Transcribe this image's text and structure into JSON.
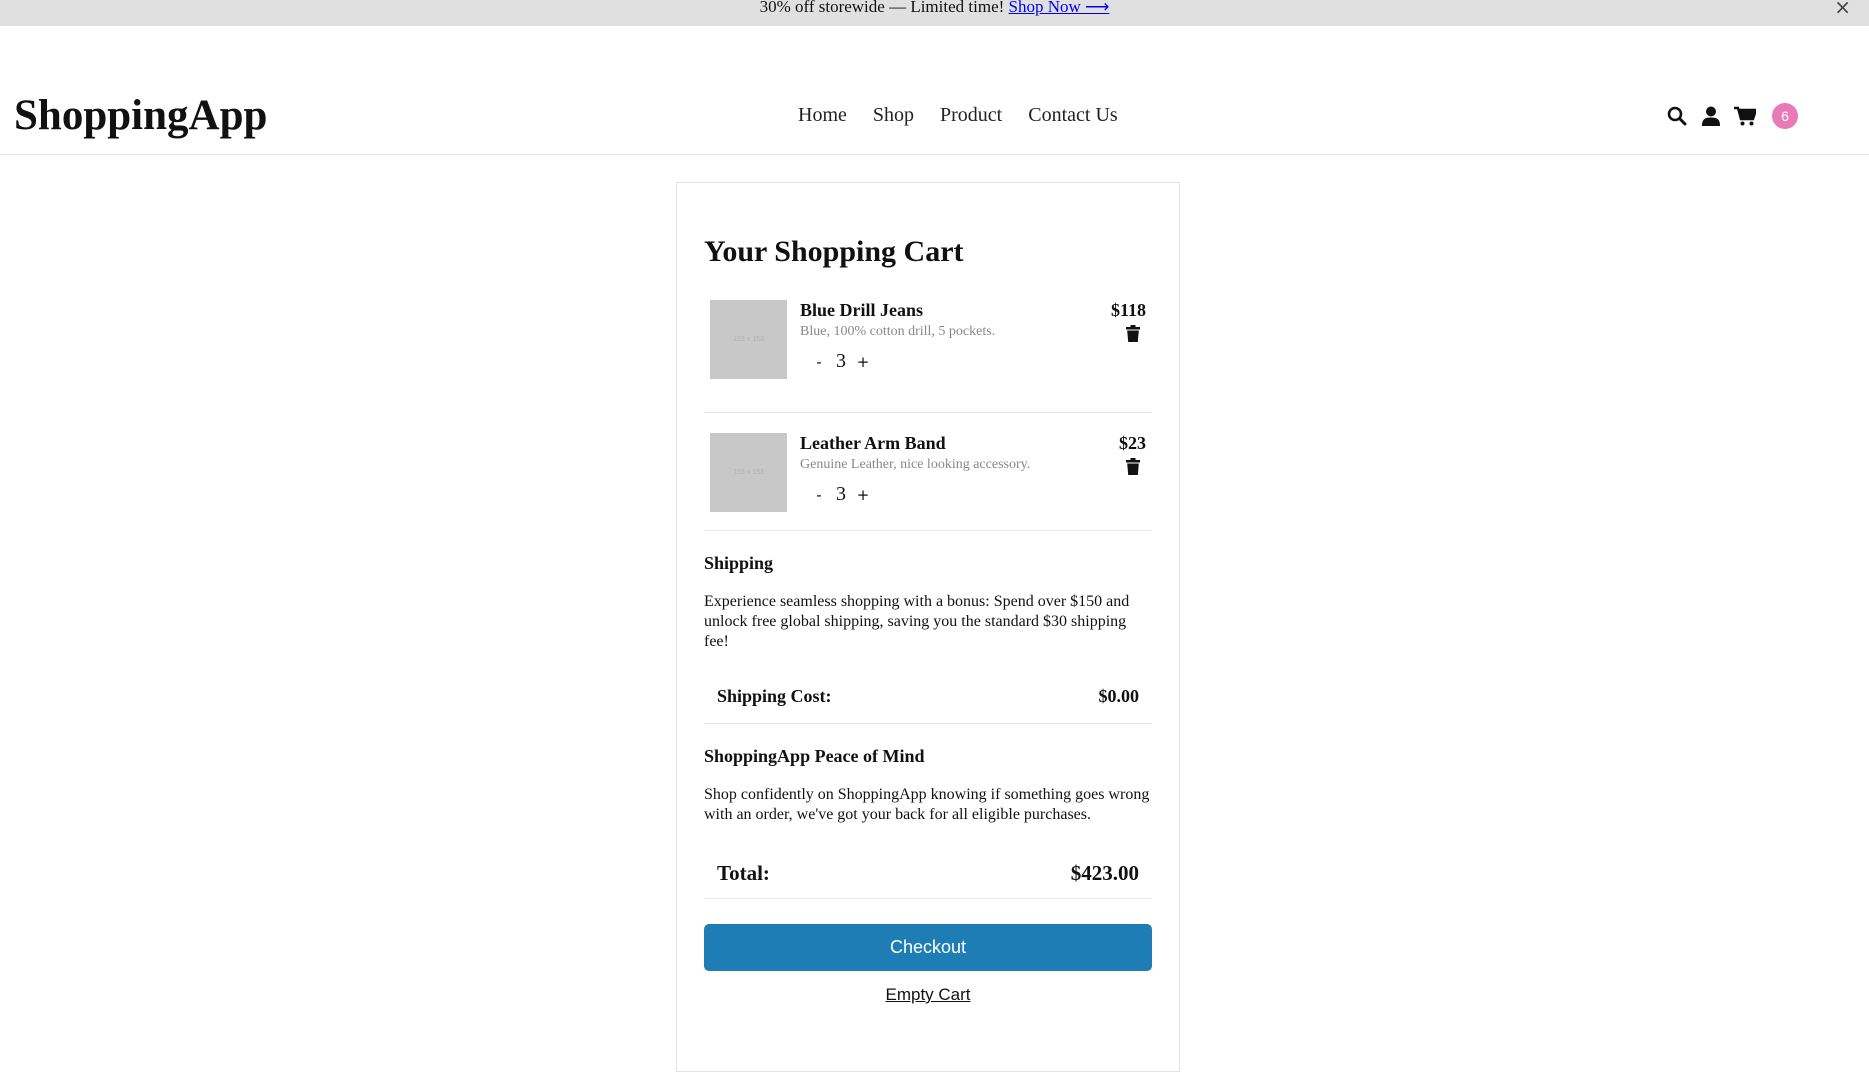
{
  "promo": {
    "text": "30% off storewide — Limited time! ",
    "link": "Shop Now ⟶",
    "close": "×"
  },
  "header": {
    "logo": "ShoppingApp",
    "nav": [
      "Home",
      "Shop",
      "Product",
      "Contact Us"
    ],
    "icons": [
      "search-icon",
      "user-icon",
      "cart-icon"
    ],
    "cart_count": "6",
    "badge_color": "#e87ab8"
  },
  "cart": {
    "title": "Your Shopping Cart",
    "items": [
      {
        "name": "Blue Drill Jeans",
        "description": "Blue, 100% cotton drill, 5 pockets.",
        "quantity": "3",
        "price": "$118",
        "thumb_text": "153 x 153",
        "decrement": "-",
        "increment": "+"
      },
      {
        "name": "Leather Arm Band",
        "description": "Genuine Leather, nice looking accessory.",
        "quantity": "3",
        "price": "$23",
        "thumb_text": "153 x 153",
        "decrement": "-",
        "increment": "+"
      }
    ],
    "shipping": {
      "title": "Shipping",
      "text": "Experience seamless shopping with a bonus: Spend over $150 and unlock free global shipping, saving you the standard $30 shipping fee!",
      "cost_label": "Shipping Cost:",
      "cost_value": "$0.00"
    },
    "peace": {
      "title": "ShoppingApp Peace of Mind",
      "text": "Shop confidently on ShoppingApp knowing if something goes wrong with an order, we've got your back for all eligible purchases."
    },
    "total_label": "Total:",
    "total_value": "$423.00",
    "checkout_label": "Checkout",
    "checkout_color": "#1e7db4",
    "empty_label": "Empty Cart"
  }
}
